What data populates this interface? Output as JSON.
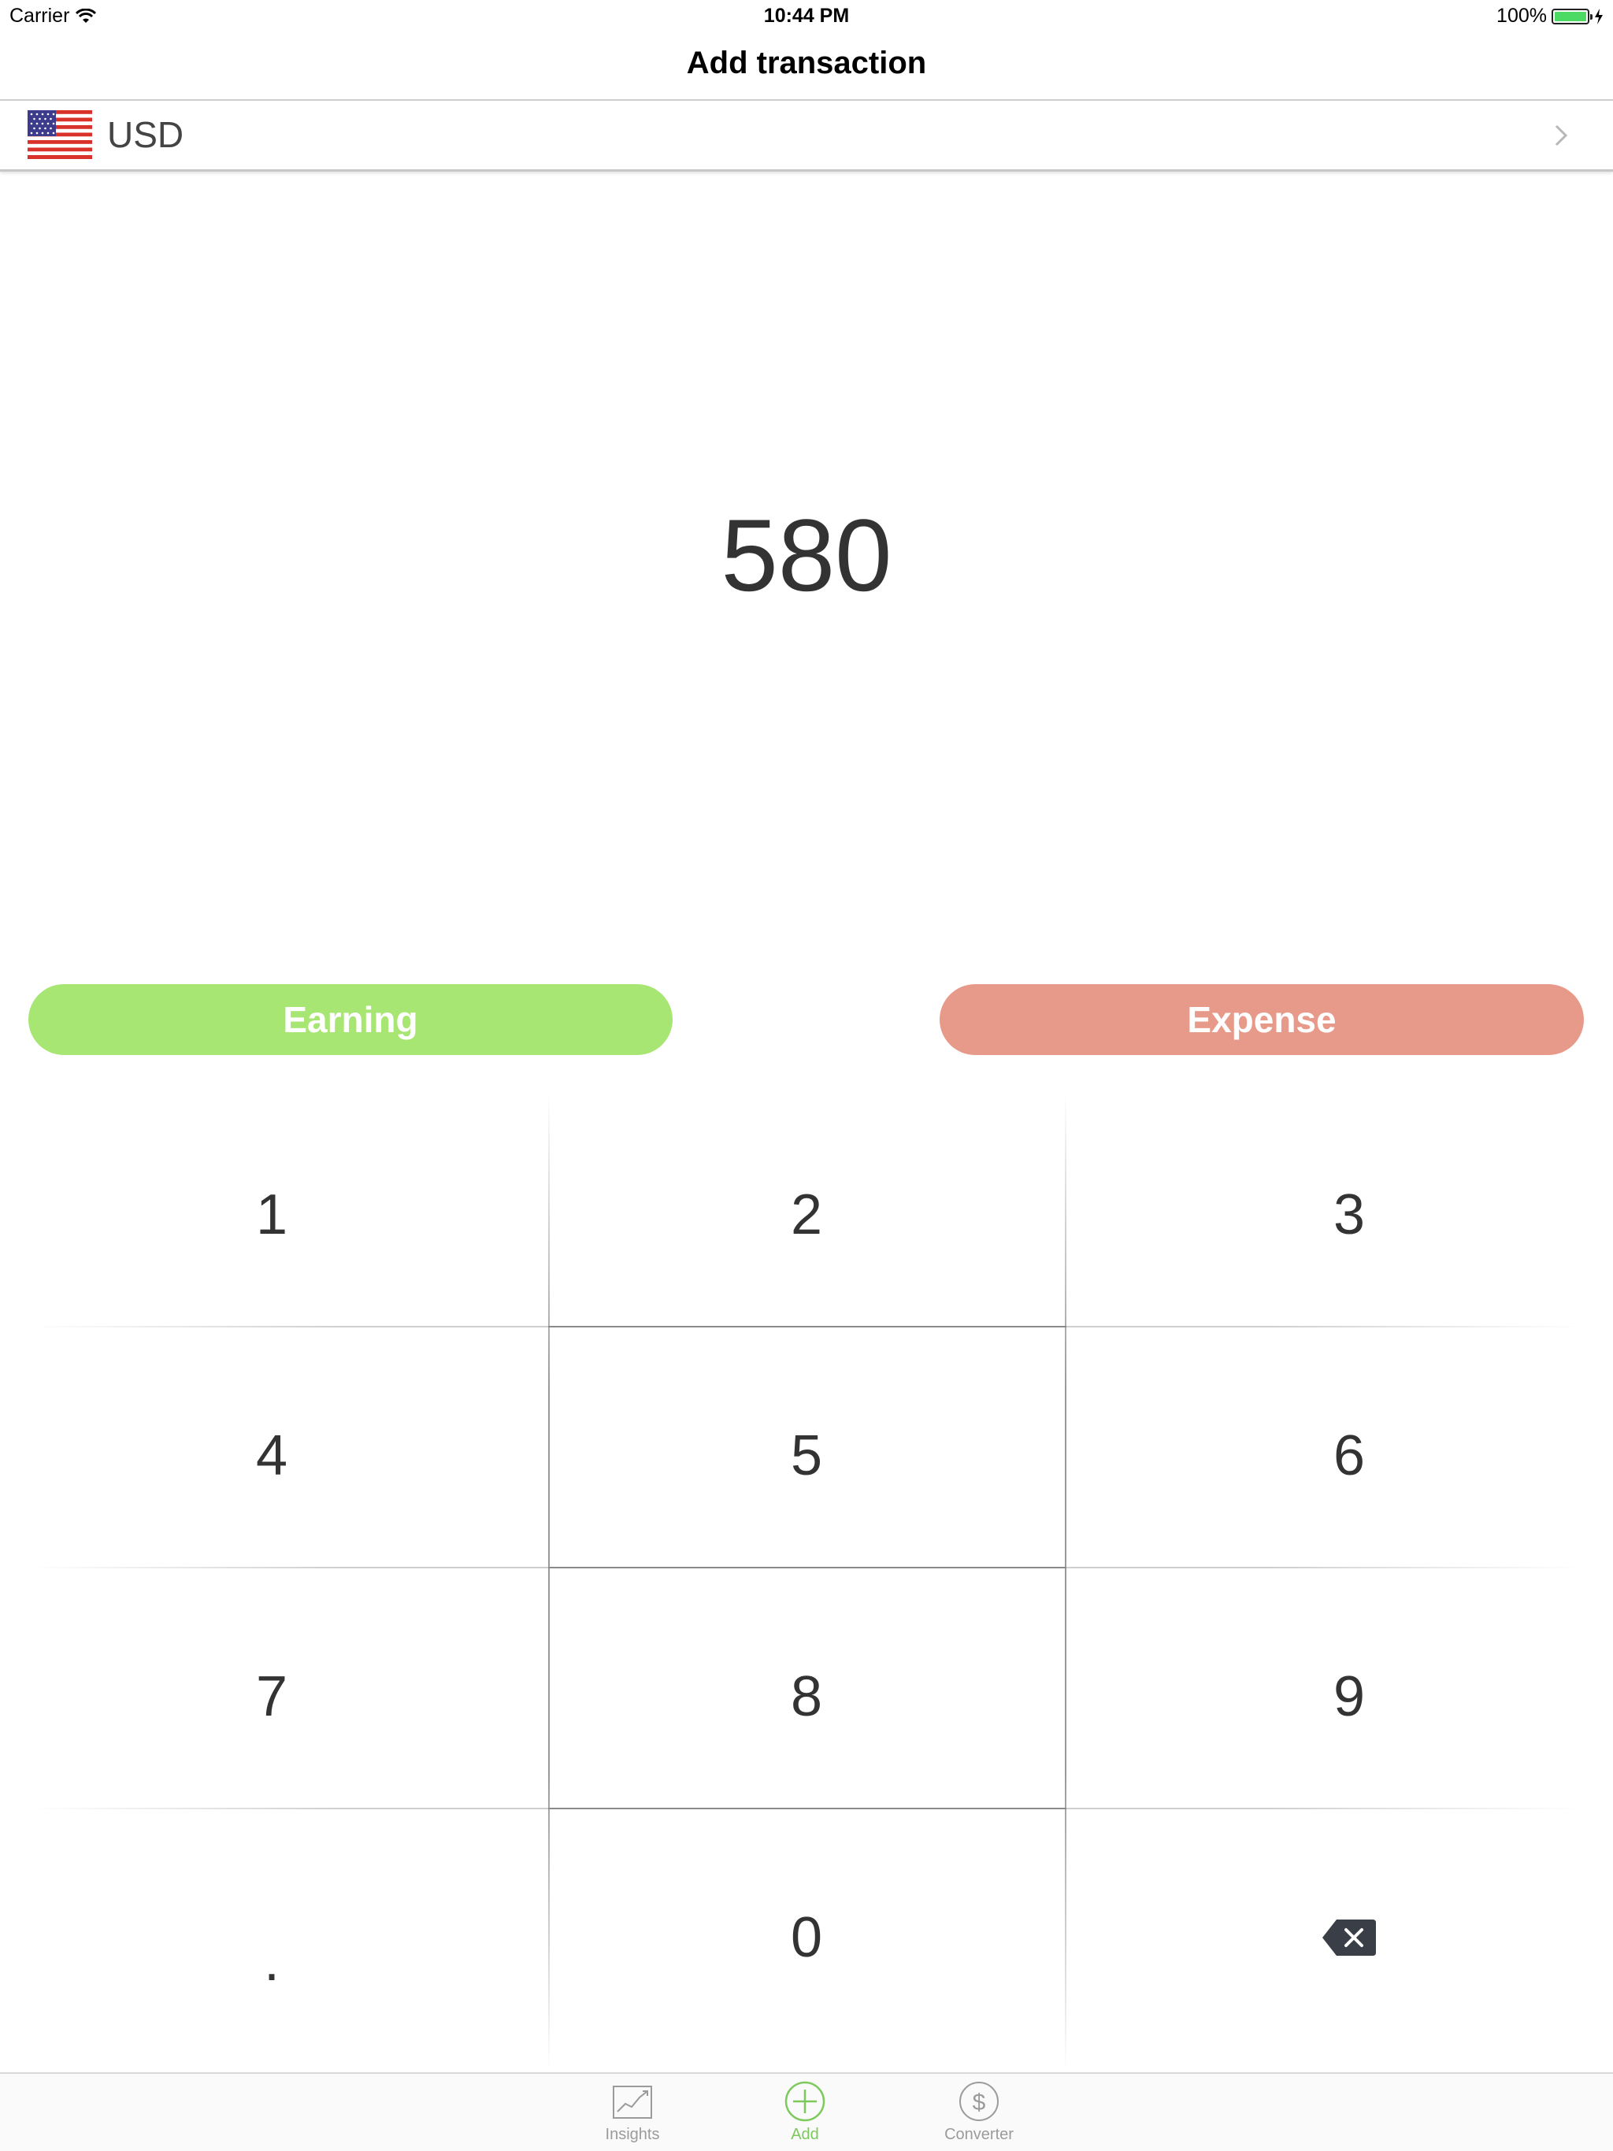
{
  "status_bar": {
    "carrier": "Carrier",
    "time": "10:44 PM",
    "battery": "100%",
    "battery_level": 1.0
  },
  "nav": {
    "title": "Add transaction"
  },
  "currency": {
    "code": "USD",
    "flag_icon": "us-flag-icon"
  },
  "amount": "580",
  "type_buttons": {
    "earning_label": "Earning",
    "expense_label": "Expense",
    "earning_color": "#a8e673",
    "expense_color": "#e89a8a"
  },
  "keypad": {
    "keys": [
      "1",
      "2",
      "3",
      "4",
      "5",
      "6",
      "7",
      "8",
      "9",
      ".",
      "0"
    ],
    "backspace_icon": "backspace-icon"
  },
  "tab_bar": {
    "tabs": [
      {
        "label": "Insights",
        "icon": "chart-icon",
        "active": false
      },
      {
        "label": "Add",
        "icon": "add-circle-icon",
        "active": true
      },
      {
        "label": "Converter",
        "icon": "dollar-circle-icon",
        "active": false
      }
    ],
    "active_color": "#7dc95e"
  }
}
